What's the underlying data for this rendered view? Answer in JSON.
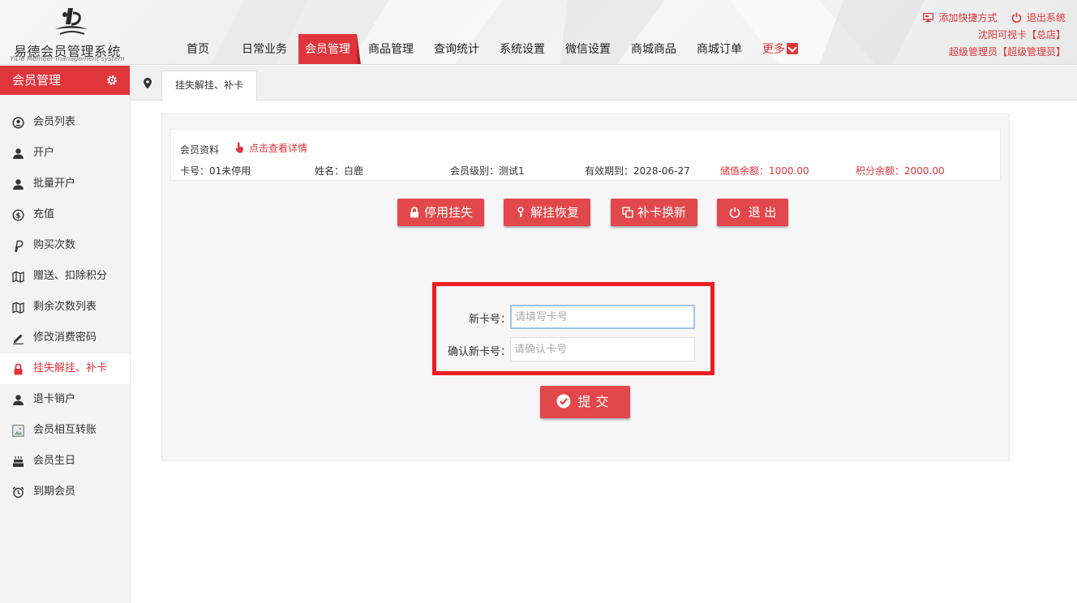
{
  "brand": {
    "name": "易德会员管理系统",
    "subtitle": "YiDe Member management system"
  },
  "nav": {
    "items": [
      {
        "label": "首页"
      },
      {
        "label": "日常业务"
      },
      {
        "label": "会员管理",
        "active": true
      },
      {
        "label": "商品管理"
      },
      {
        "label": "查询统计"
      },
      {
        "label": "系统设置"
      },
      {
        "label": "微信设置"
      },
      {
        "label": "商城商品"
      },
      {
        "label": "商城订单"
      }
    ],
    "more_label": "更多"
  },
  "top_right": {
    "shortcut_label": "添加快捷方式",
    "logout_label": "退出系统",
    "store": "沈阳可视卡【总店】",
    "user": "超级管理员【超级管理员】"
  },
  "sidebar": {
    "title": "会员管理",
    "items": [
      {
        "label": "会员列表",
        "icon": "user-circle-icon"
      },
      {
        "label": "开户",
        "icon": "user-icon"
      },
      {
        "label": "批量开户",
        "icon": "user-icon"
      },
      {
        "label": "充值",
        "icon": "dollar-circle-icon"
      },
      {
        "label": "购买次数",
        "icon": "paypal-icon"
      },
      {
        "label": "赠送、扣除积分",
        "icon": "map-icon"
      },
      {
        "label": "剩余次数列表",
        "icon": "map-icon"
      },
      {
        "label": "修改消费密码",
        "icon": "pencil-icon"
      },
      {
        "label": "挂失解挂、补卡",
        "icon": "lock-icon",
        "active": true
      },
      {
        "label": "退卡销户",
        "icon": "user-icon"
      },
      {
        "label": "会员相互转账",
        "icon": "image-icon"
      },
      {
        "label": "会员生日",
        "icon": "cake-icon"
      },
      {
        "label": "到期会员",
        "icon": "alarm-clock-icon"
      }
    ]
  },
  "tab": {
    "label": "挂失解挂、补卡"
  },
  "member_info": {
    "section_title": "会员资料",
    "detail_link": "点击查看详情",
    "fields": [
      {
        "text": "卡号：01未停用"
      },
      {
        "text": "姓名：白鹿"
      },
      {
        "text": "会员级别：测试1"
      },
      {
        "text": "有效期到：2028-06-27"
      },
      {
        "text": "储值余额：1000.00",
        "highlight": true
      },
      {
        "text": "积分余额：2000.00",
        "highlight": true
      }
    ]
  },
  "actions": {
    "suspend": "停用挂失",
    "restore": "解挂恢复",
    "replace": "补卡换新",
    "exit": "退 出"
  },
  "form": {
    "new_card_label": "新卡号：",
    "new_card_placeholder": "请填写卡号",
    "new_card_value": "",
    "confirm_card_label": "确认新卡号：",
    "confirm_card_placeholder": "请确认卡号",
    "confirm_card_value": "",
    "submit_label": "提交"
  },
  "colors": {
    "accent": "#e0353b",
    "highlight_border": "#ee1d23"
  }
}
